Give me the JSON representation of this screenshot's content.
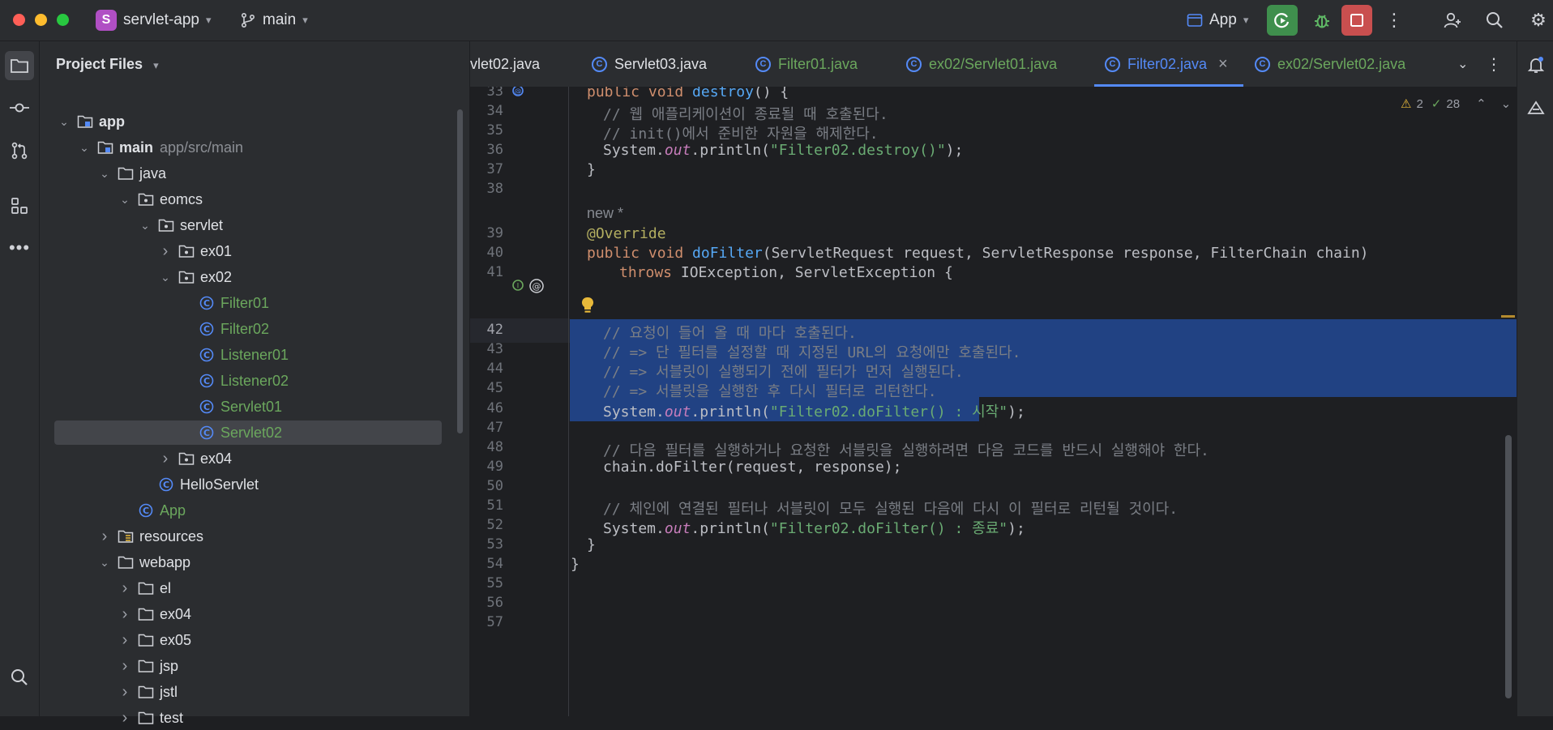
{
  "titlebar": {
    "project_initial": "S",
    "project_name": "servlet-app",
    "branch": "main",
    "run_config": "App"
  },
  "project_panel": {
    "title": "Project Files",
    "tree": [
      {
        "label": "app",
        "bold": true,
        "icon": "module-icon",
        "expanded": true
      },
      {
        "label": "main",
        "sub": "app/src/main",
        "bold": true,
        "icon": "source-root-icon",
        "expanded": true
      },
      {
        "label": "java",
        "icon": "folder-icon",
        "expanded": true
      },
      {
        "label": "eomcs",
        "icon": "package-icon",
        "expanded": true
      },
      {
        "label": "servlet",
        "icon": "package-icon",
        "expanded": true
      },
      {
        "label": "ex01",
        "icon": "package-icon",
        "expanded": false
      },
      {
        "label": "ex02",
        "icon": "package-icon",
        "expanded": true
      },
      {
        "label": "Filter01",
        "icon": "class-icon",
        "green": true
      },
      {
        "label": "Filter02",
        "icon": "class-icon",
        "green": true
      },
      {
        "label": "Listener01",
        "icon": "class-icon",
        "green": true
      },
      {
        "label": "Listener02",
        "icon": "class-icon",
        "green": true
      },
      {
        "label": "Servlet01",
        "icon": "class-icon",
        "green": true
      },
      {
        "label": "Servlet02",
        "icon": "class-icon",
        "green": true,
        "selected": true
      },
      {
        "label": "ex04",
        "icon": "package-icon",
        "expanded": false
      },
      {
        "label": "HelloServlet",
        "icon": "class-icon"
      },
      {
        "label": "App",
        "icon": "class-icon",
        "green": true
      },
      {
        "label": "resources",
        "icon": "resources-folder-icon",
        "expanded": false
      },
      {
        "label": "webapp",
        "icon": "folder-icon",
        "expanded": true
      },
      {
        "label": "el",
        "icon": "folder-icon",
        "expanded": false
      },
      {
        "label": "ex04",
        "icon": "folder-icon",
        "expanded": false
      },
      {
        "label": "ex05",
        "icon": "folder-icon",
        "expanded": false
      },
      {
        "label": "jsp",
        "icon": "folder-icon",
        "expanded": false
      },
      {
        "label": "jstl",
        "icon": "folder-icon",
        "expanded": false
      },
      {
        "label": "test",
        "icon": "folder-icon",
        "expanded": false
      }
    ]
  },
  "tabs": [
    {
      "label": "vlet02.java",
      "partial": true
    },
    {
      "label": "Servlet03.java"
    },
    {
      "label": "Filter01.java",
      "green": true
    },
    {
      "label": "ex02/Servlet01.java",
      "green": true
    },
    {
      "label": "Filter02.java",
      "active": true
    },
    {
      "label": "ex02/Servlet02.java",
      "green": true
    }
  ],
  "inspections": {
    "warnings": "2",
    "typos": "28"
  },
  "editor": {
    "line_numbers": [
      "33",
      "34",
      "35",
      "36",
      "37",
      "38",
      "",
      "39",
      "40",
      "41",
      "42",
      "43",
      "44",
      "45",
      "46",
      "47",
      "48",
      "49",
      "50",
      "51",
      "52",
      "53",
      "54",
      "55",
      "56",
      "57"
    ],
    "current_line": "42",
    "lines": {
      "l33a": "public void ",
      "l33b": "destroy",
      "l33c": "() {",
      "l34": "// 웹 애플리케이션이 종료될 때 호출된다.",
      "l35": "// init()에서 준비한 자원을 해제한다.",
      "l36a": "System.",
      "l36b": "out",
      "l36c": ".println(",
      "l36d": "\"Filter02.destroy()\"",
      "l36e": ");",
      "l37": "}",
      "hint": "new *",
      "l39": "@Override",
      "l40a": "public void ",
      "l40b": "doFilter",
      "l40c": "(ServletRequest request, ServletResponse response, FilterChain chain)",
      "l41a": "throws ",
      "l41b": "IOException, ServletException {",
      "l42": "// 요청이 들어 올 때 마다 호출된다.",
      "l43": "// => 단 필터를 설정할 때 지정된 URL의 요청에만 호출된다.",
      "l44": "// => 서블릿이 실행되기 전에 필터가 먼저 실행된다.",
      "l45": "// => 서블릿을 실행한 후 다시 필터로 리턴한다.",
      "l46a": "System.",
      "l46b": "out",
      "l46c": ".println(",
      "l46d": "\"Filter02.doFilter() : 시작\"",
      "l46e": ");",
      "l48": "// 다음 필터를 실행하거나 요청한 서블릿을 실행하려면 다음 코드를 반드시 실행해야 한다.",
      "l49": "chain.doFilter(request, response);",
      "l51": "// 체인에 연결된 필터나 서블릿이 모두 실행된 다음에 다시 이 필터로 리턴될 것이다.",
      "l52a": "System.",
      "l52b": "out",
      "l52c": ".println(",
      "l52d": "\"Filter02.doFilter() : 종료\"",
      "l52e": ");",
      "l53": "}",
      "l54": "}"
    }
  },
  "colors": {
    "accent": "#548af7",
    "selection": "#214283",
    "green_file": "#6ba75d",
    "run_button": "#3f8f4d",
    "stop_button": "#c94f4f"
  }
}
